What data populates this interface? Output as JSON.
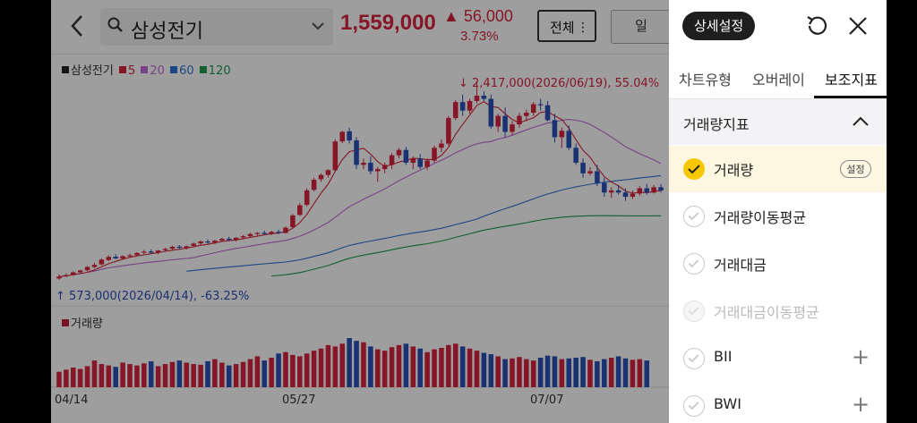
{
  "header": {
    "back_icon": "chevron-left-icon",
    "search_icon": "search-icon",
    "stock_name": "삼성전기",
    "dropdown_icon": "chevron-down-icon",
    "price": "1,559,000",
    "change": "▲ 56,000",
    "change_pct": "3.73%",
    "btn_all": "전체",
    "btn_all_dots": "⋮",
    "btn_period": "일"
  },
  "legend": {
    "name": "삼성전기",
    "ma5": "5",
    "ma20": "20",
    "ma60": "60",
    "ma120": "120"
  },
  "annotations": {
    "high": "2,417,000(2026/06/19), 55.04%",
    "low": "573,000(2026/04/14), -63.25%",
    "volume_label": "거래량"
  },
  "x_ticks": [
    "04/14",
    "05/27",
    "07/07"
  ],
  "colors": {
    "up": "#d9243e",
    "down": "#2b4fb8",
    "ma5": "#d9243e",
    "ma20": "#c46ad8",
    "ma60": "#2d74d6",
    "ma120": "#1e9a4e",
    "panel_accent": "#f7c800"
  },
  "panel": {
    "title": "상세설정",
    "reset_icon": "refresh-icon",
    "close_icon": "close-icon",
    "tabs": [
      "차트유형",
      "오버레이",
      "보조지표"
    ],
    "active_tab": 2,
    "section_title": "거래량지표",
    "section_icon": "chevron-up-icon",
    "items": [
      {
        "label": "거래량",
        "checked": true,
        "settings": "설정"
      },
      {
        "label": "거래량이동평균",
        "checked": false
      },
      {
        "label": "거래대금",
        "checked": false
      },
      {
        "label": "거래대금이동평균",
        "checked": false,
        "disabled": true
      },
      {
        "label": "BII",
        "checked": false,
        "add": "+"
      },
      {
        "label": "BWI",
        "checked": false,
        "add": "+"
      }
    ]
  },
  "chart_data": {
    "type": "candlestick",
    "x_start": "04/14",
    "ylim": [
      500000,
      2500000
    ],
    "candles": [
      [
        573000,
        610000,
        560000,
        590000
      ],
      [
        592000,
        620000,
        585000,
        605000
      ],
      [
        604000,
        640000,
        598000,
        630000
      ],
      [
        630000,
        655000,
        620000,
        648000
      ],
      [
        650000,
        690000,
        640000,
        680000
      ],
      [
        680000,
        720000,
        670000,
        700000
      ],
      [
        705000,
        760000,
        695000,
        750000
      ],
      [
        745000,
        790000,
        735000,
        775000
      ],
      [
        776000,
        800000,
        755000,
        760000
      ],
      [
        760000,
        790000,
        750000,
        782000
      ],
      [
        784000,
        805000,
        770000,
        790000
      ],
      [
        792000,
        820000,
        780000,
        812000
      ],
      [
        815000,
        840000,
        800000,
        825000
      ],
      [
        826000,
        845000,
        805000,
        815000
      ],
      [
        815000,
        840000,
        800000,
        835000
      ],
      [
        838000,
        860000,
        825000,
        850000
      ],
      [
        852000,
        880000,
        840000,
        870000
      ],
      [
        872000,
        885000,
        850000,
        860000
      ],
      [
        858000,
        880000,
        845000,
        875000
      ],
      [
        880000,
        910000,
        870000,
        900000
      ],
      [
        902000,
        930000,
        890000,
        920000
      ],
      [
        920000,
        940000,
        900000,
        910000
      ],
      [
        910000,
        935000,
        895000,
        928000
      ],
      [
        930000,
        955000,
        915000,
        945000
      ],
      [
        946000,
        965000,
        925000,
        935000
      ],
      [
        935000,
        960000,
        920000,
        955000
      ],
      [
        958000,
        980000,
        940000,
        970000
      ],
      [
        970000,
        1000000,
        960000,
        990000
      ],
      [
        990000,
        1010000,
        975000,
        1000000
      ],
      [
        1002000,
        1020000,
        985000,
        995000
      ],
      [
        995000,
        1020000,
        980000,
        1010000
      ],
      [
        1010000,
        1030000,
        990000,
        1000000
      ],
      [
        1000000,
        1060000,
        995000,
        1050000
      ],
      [
        1055000,
        1180000,
        1045000,
        1165000
      ],
      [
        1170000,
        1280000,
        1160000,
        1260000
      ],
      [
        1265000,
        1420000,
        1250000,
        1400000
      ],
      [
        1405000,
        1520000,
        1390000,
        1500000
      ],
      [
        1505000,
        1560000,
        1480000,
        1545000
      ],
      [
        1545000,
        1600000,
        1520000,
        1590000
      ],
      [
        1590000,
        1880000,
        1575000,
        1860000
      ],
      [
        1860000,
        1960000,
        1845000,
        1950000
      ],
      [
        1955000,
        1990000,
        1840000,
        1870000
      ],
      [
        1870000,
        1900000,
        1600000,
        1640000
      ],
      [
        1640000,
        1700000,
        1600000,
        1660000
      ],
      [
        1660000,
        1720000,
        1550000,
        1580000
      ],
      [
        1580000,
        1620000,
        1480000,
        1600000
      ],
      [
        1600000,
        1660000,
        1560000,
        1640000
      ],
      [
        1640000,
        1750000,
        1600000,
        1730000
      ],
      [
        1730000,
        1800000,
        1700000,
        1780000
      ],
      [
        1780000,
        1810000,
        1640000,
        1660000
      ],
      [
        1660000,
        1720000,
        1600000,
        1700000
      ],
      [
        1700000,
        1740000,
        1600000,
        1620000
      ],
      [
        1620000,
        1700000,
        1590000,
        1680000
      ],
      [
        1680000,
        1820000,
        1660000,
        1800000
      ],
      [
        1800000,
        1880000,
        1760000,
        1840000
      ],
      [
        1840000,
        2100000,
        1820000,
        2080000
      ],
      [
        2080000,
        2250000,
        2060000,
        2230000
      ],
      [
        2230000,
        2300000,
        2100000,
        2150000
      ],
      [
        2150000,
        2260000,
        2120000,
        2240000
      ],
      [
        2240000,
        2417000,
        2220000,
        2290000
      ],
      [
        2290000,
        2330000,
        2240000,
        2260000
      ],
      [
        2260000,
        2300000,
        1980000,
        2000000
      ],
      [
        2000000,
        2120000,
        1950000,
        2100000
      ],
      [
        2100000,
        2180000,
        1900000,
        1950000
      ],
      [
        1950000,
        2050000,
        1920000,
        2020000
      ],
      [
        2020000,
        2130000,
        1990000,
        2100000
      ],
      [
        2100000,
        2160000,
        2050000,
        2130000
      ],
      [
        2130000,
        2230000,
        2100000,
        2210000
      ],
      [
        2210000,
        2260000,
        2150000,
        2200000
      ],
      [
        2200000,
        2240000,
        2050000,
        2060000
      ],
      [
        2060000,
        2120000,
        1850000,
        1900000
      ],
      [
        1900000,
        1990000,
        1800000,
        1960000
      ],
      [
        1960000,
        2010000,
        1780000,
        1800000
      ],
      [
        1800000,
        1840000,
        1640000,
        1660000
      ],
      [
        1660000,
        1700000,
        1520000,
        1560000
      ],
      [
        1560000,
        1620000,
        1540000,
        1580000
      ],
      [
        1580000,
        1640000,
        1440000,
        1470000
      ],
      [
        1470000,
        1520000,
        1340000,
        1380000
      ],
      [
        1380000,
        1430000,
        1330000,
        1400000
      ],
      [
        1400000,
        1450000,
        1360000,
        1380000
      ],
      [
        1380000,
        1420000,
        1300000,
        1340000
      ],
      [
        1340000,
        1400000,
        1320000,
        1370000
      ],
      [
        1370000,
        1440000,
        1350000,
        1420000
      ],
      [
        1420000,
        1460000,
        1360000,
        1380000
      ],
      [
        1380000,
        1450000,
        1370000,
        1430000
      ],
      [
        1430000,
        1460000,
        1380000,
        1400000
      ]
    ],
    "volume": [
      22,
      25,
      28,
      26,
      30,
      38,
      33,
      31,
      29,
      35,
      33,
      31,
      34,
      37,
      30,
      33,
      36,
      38,
      35,
      33,
      32,
      37,
      40,
      35,
      31,
      33,
      36,
      40,
      44,
      38,
      42,
      48,
      50,
      46,
      44,
      48,
      52,
      55,
      60,
      58,
      62,
      70,
      66,
      64,
      58,
      54,
      52,
      57,
      60,
      62,
      58,
      55,
      50,
      54,
      56,
      60,
      62,
      58,
      55,
      52,
      49,
      47,
      44,
      40,
      41,
      43,
      40,
      38,
      42,
      45,
      44,
      40,
      41,
      42,
      43,
      39,
      37,
      40,
      42,
      44,
      41,
      39,
      40,
      38
    ]
  }
}
